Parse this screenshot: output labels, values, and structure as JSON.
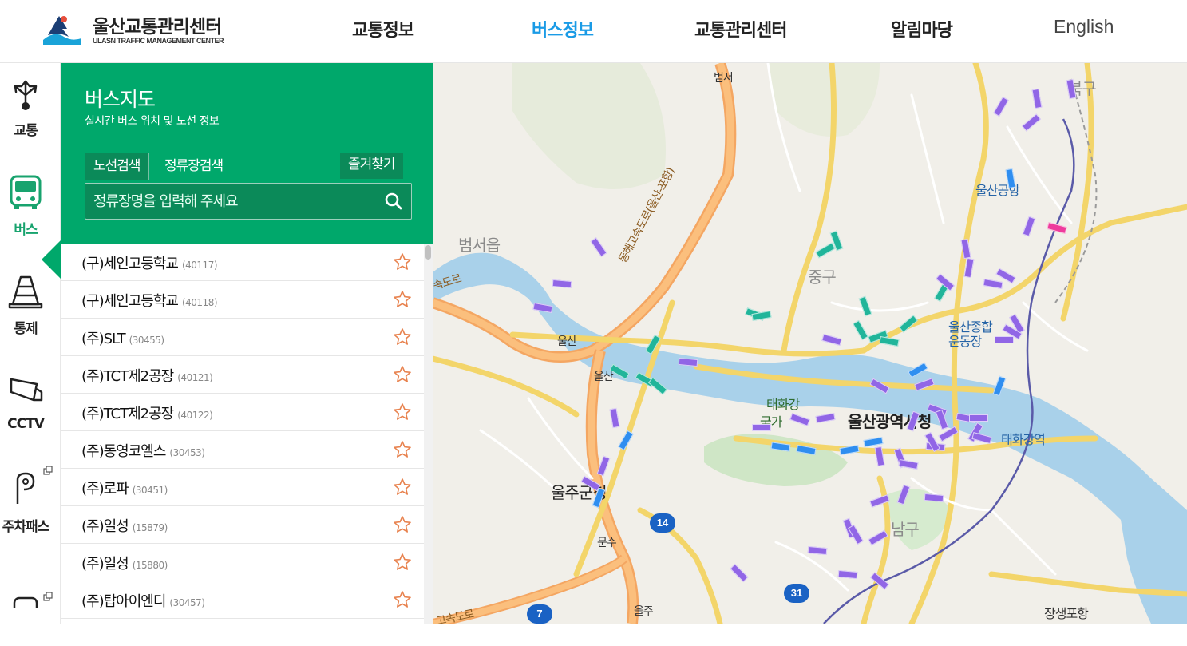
{
  "header": {
    "logo_title": "울산교통관리센터",
    "logo_subtitle": "ULASN TRAFFIC MANAGEMENT CENTER",
    "nav": [
      {
        "label": "교통정보",
        "active": false
      },
      {
        "label": "버스정보",
        "active": true
      },
      {
        "label": "교통관리센터",
        "active": false
      },
      {
        "label": "알림마당",
        "active": false
      },
      {
        "label": "English",
        "active": false
      }
    ]
  },
  "leftbar": {
    "items": [
      {
        "label": "교통",
        "icon": "directions-icon",
        "active": false
      },
      {
        "label": "버스",
        "icon": "bus-icon",
        "active": true
      },
      {
        "label": "통제",
        "icon": "traffic-cone-icon",
        "active": false
      },
      {
        "label": "CCTV",
        "icon": "cctv-icon",
        "active": false
      },
      {
        "label": "주차패스",
        "icon": "parking-pass-icon",
        "active": false
      }
    ]
  },
  "panel": {
    "title": "버스지도",
    "subtitle": "실시간 버스 위치 및 노선 정보",
    "tabs": [
      {
        "label": "노선검색",
        "active": false
      },
      {
        "label": "정류장검색",
        "active": true
      }
    ],
    "favorites_label": "즐겨찾기",
    "search_placeholder": "정류장명을 입력해 주세요"
  },
  "stops": [
    {
      "name": "(구)세인고등학교",
      "id": "(40117)"
    },
    {
      "name": "(구)세인고등학교",
      "id": "(40118)"
    },
    {
      "name": "(주)SLT",
      "id": "(30455)"
    },
    {
      "name": "(주)TCT제2공장",
      "id": "(40121)"
    },
    {
      "name": "(주)TCT제2공장",
      "id": "(40122)"
    },
    {
      "name": "(주)동영코엘스",
      "id": "(30453)"
    },
    {
      "name": "(주)로파",
      "id": "(30451)"
    },
    {
      "name": "(주)일성",
      "id": "(15879)"
    },
    {
      "name": "(주)일성",
      "id": "(15880)"
    },
    {
      "name": "(주)탑아이엔디",
      "id": "(30457)"
    }
  ],
  "map": {
    "labels": {
      "beomseo": "범서",
      "beomseoeup": "범서읍",
      "junggu": "중구",
      "ulsan_airport": "울산공항",
      "bukgu": "북구",
      "ulsan": "울산",
      "ulsan_ic": "울산",
      "taehwagang": "태화강",
      "national_garden": "국가",
      "city_hall": "울산광역시청",
      "sports_complex": "울산종합\n운동장",
      "ulju_office": "울주군청",
      "munsu": "문수",
      "namgu": "남구",
      "taehwagang_station": "태화강역",
      "ulju": "울주",
      "jangsaengpo": "장생포항",
      "expressway": "동해고속도로(울산-포항)",
      "gosokdoro": "속도로",
      "gosokdoro2": "고속도로"
    },
    "route_shields": [
      "14",
      "31",
      "7"
    ],
    "colors": {
      "purple": "#9166e6",
      "teal": "#21b59a",
      "blue": "#2f8ef0",
      "pink": "#ee3b9c"
    }
  }
}
